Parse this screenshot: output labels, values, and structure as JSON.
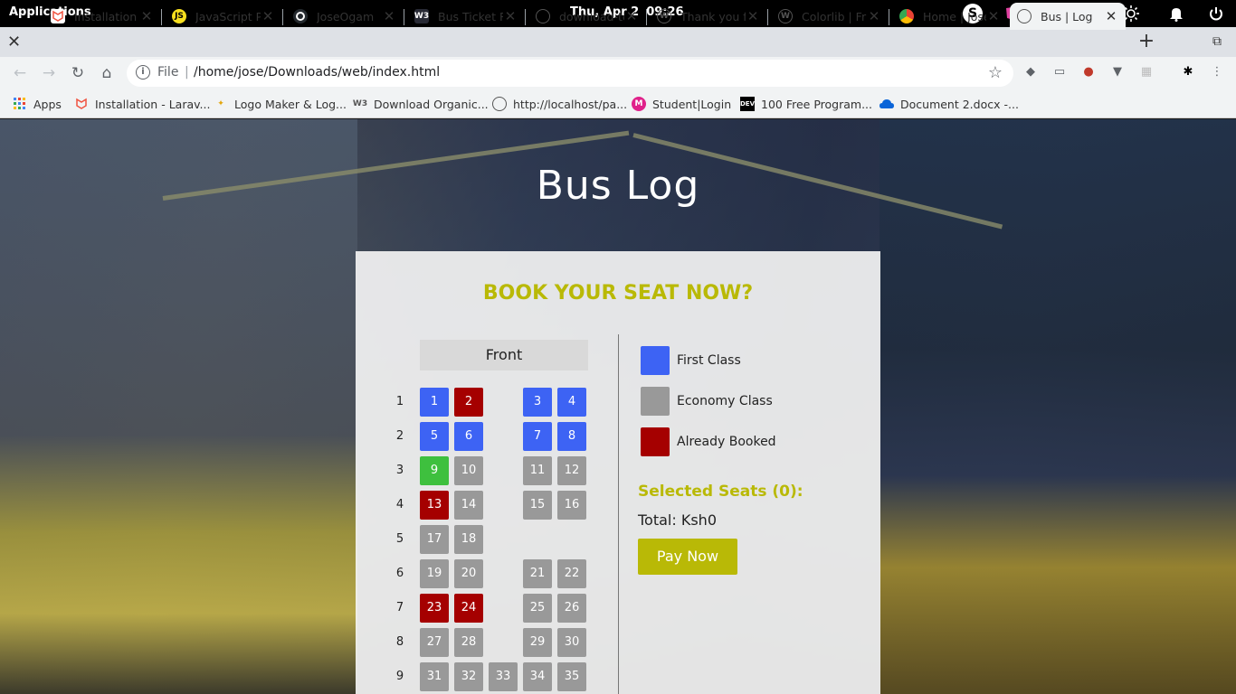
{
  "os": {
    "apps_label": "Applications",
    "date": "Thu, Apr  2",
    "time": "09:26"
  },
  "tabs": [
    {
      "title": "Installation -",
      "icon": "laravel-icon"
    },
    {
      "title": "JavaScript Pr",
      "icon": "js-icon"
    },
    {
      "title": "JoseOgam",
      "icon": "github-icon"
    },
    {
      "title": "Bus Ticket Re",
      "icon": "w3schools-icon"
    },
    {
      "title": "download-te",
      "icon": "globe-icon"
    },
    {
      "title": "Thank you fo",
      "icon": "wordpress-icon"
    },
    {
      "title": "Colorlib | Fr",
      "icon": "wordpress-icon"
    },
    {
      "title": "Home | Jose",
      "icon": "chrome-icon"
    },
    {
      "title": "Bus | Log",
      "icon": "globe-icon",
      "active": true
    }
  ],
  "omnibox": {
    "scheme_label": "File",
    "url": "/home/jose/Downloads/web/index.html"
  },
  "bookmarks": [
    {
      "label": "Apps"
    },
    {
      "label": "Installation - Larav..."
    },
    {
      "label": "Logo Maker & Log..."
    },
    {
      "label": "Download Organic..."
    },
    {
      "label": "http://localhost/pa..."
    },
    {
      "label": "Student|Login"
    },
    {
      "label": "100 Free Program..."
    },
    {
      "label": "Document 2.docx -..."
    }
  ],
  "page": {
    "title": "Bus Log",
    "heading": "BOOK YOUR SEAT NOW?",
    "front_label": "Front",
    "legend": [
      {
        "label": "First Class",
        "color": "#3d63f4"
      },
      {
        "label": "Economy Class",
        "color": "#999999"
      },
      {
        "label": "Already Booked",
        "color": "#a50000"
      }
    ],
    "selected_seats_label": "Selected Seats (0):",
    "total_label": "Total: Ksh0",
    "pay_button": "Pay Now"
  },
  "rows": [
    {
      "num": "1",
      "seats": [
        {
          "n": "1",
          "s": "first"
        },
        {
          "n": "2",
          "s": "booked"
        },
        {
          "n": "3",
          "s": "first"
        },
        {
          "n": "4",
          "s": "first"
        }
      ]
    },
    {
      "num": "2",
      "seats": [
        {
          "n": "5",
          "s": "first"
        },
        {
          "n": "6",
          "s": "first"
        },
        {
          "n": "7",
          "s": "first"
        },
        {
          "n": "8",
          "s": "first"
        }
      ]
    },
    {
      "num": "3",
      "seats": [
        {
          "n": "9",
          "s": "selected"
        },
        {
          "n": "10",
          "s": "economy"
        },
        {
          "n": "11",
          "s": "economy"
        },
        {
          "n": "12",
          "s": "economy"
        }
      ]
    },
    {
      "num": "4",
      "seats": [
        {
          "n": "13",
          "s": "booked"
        },
        {
          "n": "14",
          "s": "economy"
        },
        {
          "n": "15",
          "s": "economy"
        },
        {
          "n": "16",
          "s": "economy"
        }
      ]
    },
    {
      "num": "5",
      "seats": [
        {
          "n": "17",
          "s": "economy"
        },
        {
          "n": "18",
          "s": "economy"
        }
      ]
    },
    {
      "num": "6",
      "seats": [
        {
          "n": "19",
          "s": "economy"
        },
        {
          "n": "20",
          "s": "economy"
        },
        {
          "n": "21",
          "s": "economy"
        },
        {
          "n": "22",
          "s": "economy"
        }
      ]
    },
    {
      "num": "7",
      "seats": [
        {
          "n": "23",
          "s": "booked"
        },
        {
          "n": "24",
          "s": "booked"
        },
        {
          "n": "25",
          "s": "economy"
        },
        {
          "n": "26",
          "s": "economy"
        }
      ]
    },
    {
      "num": "8",
      "seats": [
        {
          "n": "27",
          "s": "economy"
        },
        {
          "n": "28",
          "s": "economy"
        },
        {
          "n": "29",
          "s": "economy"
        },
        {
          "n": "30",
          "s": "economy"
        }
      ]
    },
    {
      "num": "9",
      "seats": [
        {
          "n": "31",
          "s": "economy"
        },
        {
          "n": "32",
          "s": "economy"
        },
        {
          "n": "33",
          "s": "economy"
        },
        {
          "n": "34",
          "s": "economy"
        },
        {
          "n": "35",
          "s": "economy"
        }
      ]
    }
  ]
}
